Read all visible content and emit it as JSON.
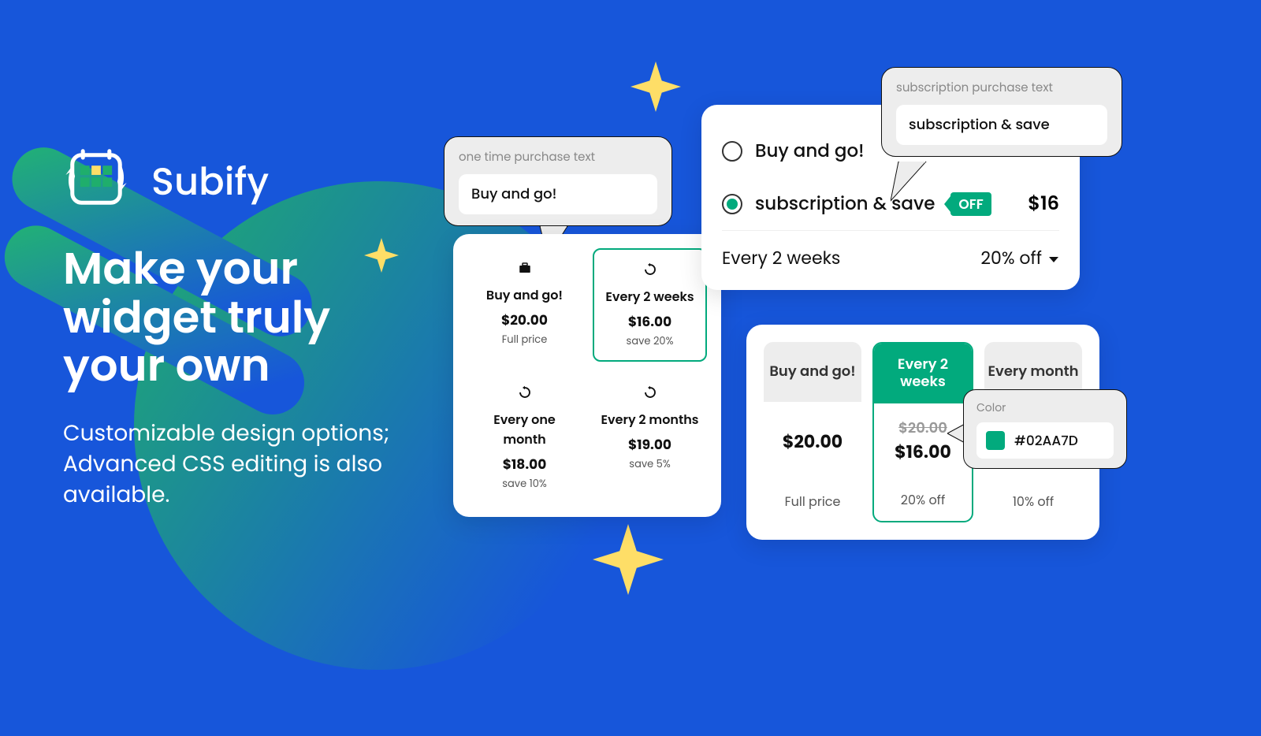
{
  "brand": {
    "name": "Subify"
  },
  "hero": {
    "headline": "Make your widget truly your own",
    "subtext": "Customizable design options; Advanced CSS editing is also available."
  },
  "bubble_left": {
    "label": "one time purchase text",
    "value": "Buy and go!"
  },
  "bubble_right": {
    "label": "subscription purchase text",
    "value": "subscription & save"
  },
  "grid_card": {
    "tiles": [
      {
        "title": "Buy and go!",
        "price": "$20.00",
        "sub": "Full price"
      },
      {
        "title": "Every 2 weeks",
        "price": "$16.00",
        "sub": "save 20%"
      },
      {
        "title": "Every one month",
        "price": "$18.00",
        "sub": "save 10%"
      },
      {
        "title": "Every 2 months",
        "price": "$19.00",
        "sub": "save 5%"
      }
    ]
  },
  "radio_card": {
    "option_unchecked": "Buy and go!",
    "option_checked": "subscription & save",
    "tag": "OFF",
    "price": "$16",
    "freq_label": "Every 2 weeks",
    "freq_discount": "20% off"
  },
  "column_card": {
    "cols": [
      {
        "head": "Buy and go!",
        "old": "",
        "price": "$20.00",
        "foot": "Full price"
      },
      {
        "head": "Every 2 weeks",
        "old": "$20.00",
        "price": "$16.00",
        "foot": "20% off"
      },
      {
        "head": "Every month",
        "old": "",
        "price": "",
        "foot": "10% off"
      }
    ]
  },
  "color_picker": {
    "label": "Color",
    "hex": "#02AA7D"
  },
  "colors": {
    "accent": "#02AA7D",
    "star": "#FEDE67"
  }
}
